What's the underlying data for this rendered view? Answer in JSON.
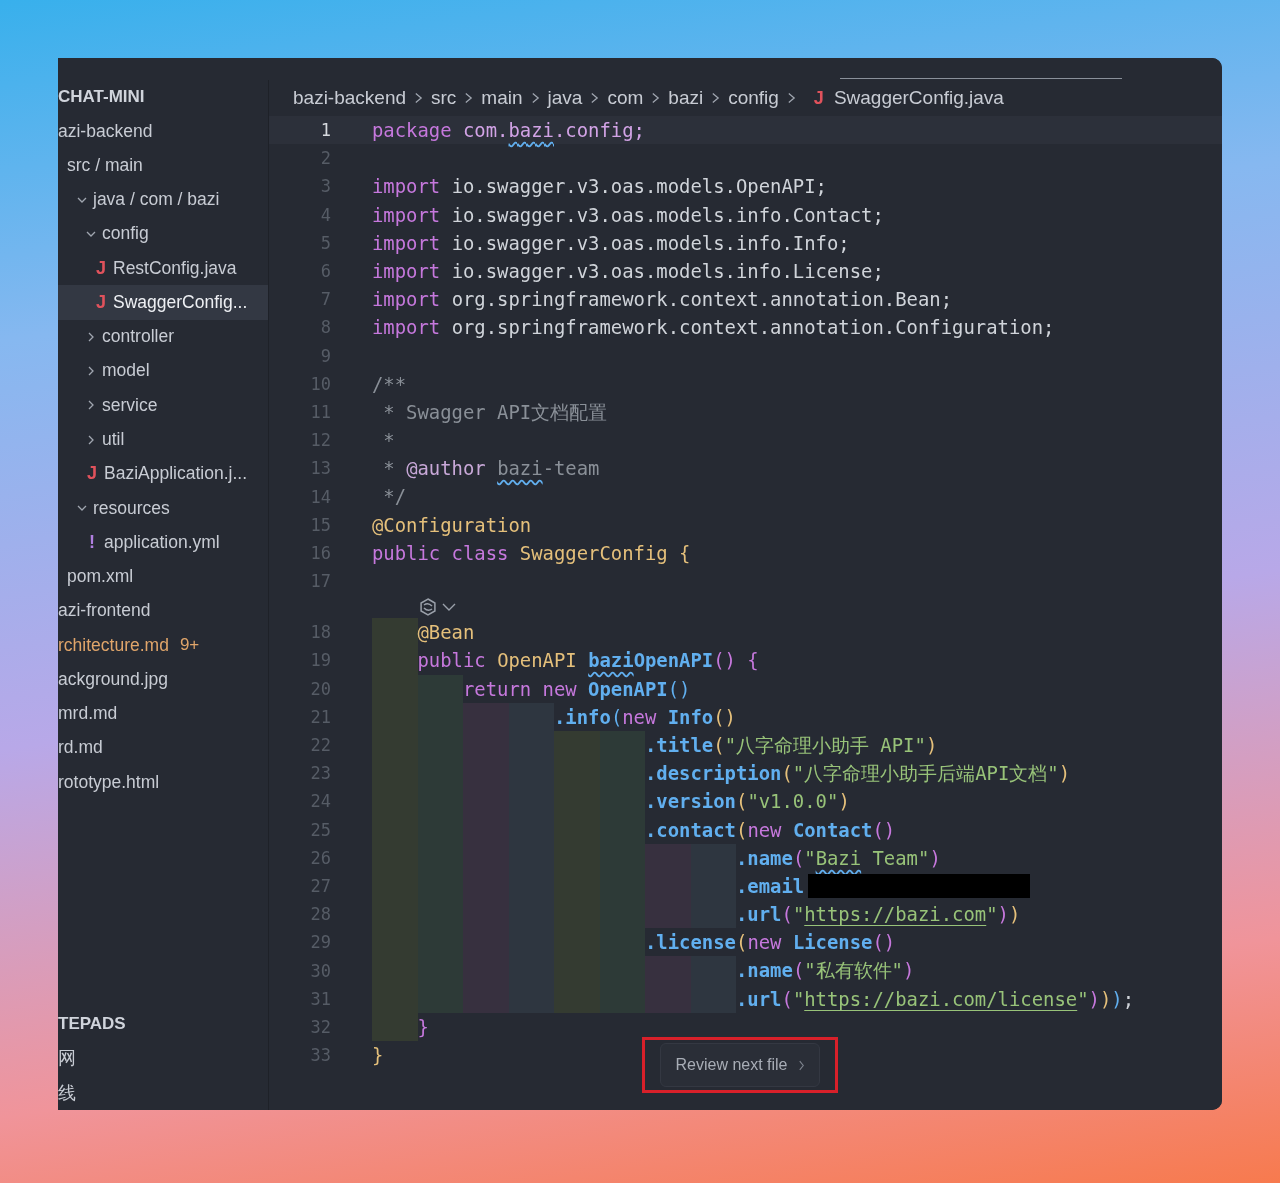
{
  "sidebar": {
    "title": "CHAT-MINI",
    "items": [
      {
        "label": "azi-backend",
        "selected": false,
        "modified": false,
        "children": [
          {
            "label": "src / main",
            "selected": false,
            "children": [
              {
                "label": "java / com / bazi",
                "expanded": true,
                "selected": false,
                "children": [
                  {
                    "label": "config",
                    "expanded": true,
                    "selected": false,
                    "children": [
                      {
                        "label": "RestConfig.java",
                        "icon": "J",
                        "color": "#e0525c",
                        "selected": false
                      },
                      {
                        "label": "SwaggerConfig...",
                        "icon": "J",
                        "color": "#e0525c",
                        "selected": true
                      }
                    ]
                  },
                  {
                    "label": "controller",
                    "expanded": false,
                    "selected": false
                  },
                  {
                    "label": "model",
                    "expanded": false,
                    "selected": false
                  },
                  {
                    "label": "service",
                    "expanded": false,
                    "selected": false
                  },
                  {
                    "label": "util",
                    "expanded": false,
                    "selected": false
                  },
                  {
                    "label": "BaziApplication.j...",
                    "icon": "J",
                    "color": "#e0525c",
                    "selected": false
                  }
                ]
              },
              {
                "label": "resources",
                "expanded": true,
                "selected": false,
                "children": [
                  {
                    "label": "application.yml",
                    "icon": "!",
                    "color": "#b07fe0",
                    "selected": false
                  }
                ]
              }
            ]
          },
          {
            "label": "pom.xml",
            "selected": false
          }
        ]
      },
      {
        "label": "azi-frontend",
        "selected": false,
        "modified": false
      },
      {
        "label": "rchitecture.md",
        "selected": false,
        "modified": true,
        "badge": "9+"
      },
      {
        "label": "ackground.jpg",
        "selected": false,
        "modified": false
      },
      {
        "label": "mrd.md",
        "selected": false,
        "modified": false
      },
      {
        "label": "rd.md",
        "selected": false,
        "modified": false
      },
      {
        "label": "rototype.html",
        "selected": false,
        "modified": false
      }
    ],
    "section": {
      "title": "TEPADS",
      "items": [
        {
          "label": "网"
        },
        {
          "label": "线"
        }
      ]
    }
  },
  "breadcrumb": [
    {
      "label": "bazi-backend"
    },
    {
      "label": "src"
    },
    {
      "label": "main"
    },
    {
      "label": "java"
    },
    {
      "label": "com"
    },
    {
      "label": "bazi"
    },
    {
      "label": "config"
    },
    {
      "label": "SwaggerConfig.java",
      "icon": "J"
    }
  ],
  "editor": {
    "lines": [
      {
        "kind": "code",
        "number": "1",
        "current": true,
        "tokens": [
          {
            "kind": "kw",
            "text": "package "
          },
          {
            "kind": "pkg",
            "text": "com."
          },
          {
            "kind": "pkgsq",
            "text": "bazi"
          },
          {
            "kind": "pkg",
            "text": ".config;"
          }
        ]
      },
      {
        "kind": "code",
        "number": "2",
        "current": false
      },
      {
        "kind": "code",
        "number": "3",
        "current": false,
        "tokens": [
          {
            "kind": "kw",
            "text": "import "
          },
          {
            "kind": "plain",
            "text": "io.swagger.v3.oas.models.OpenAPI;"
          }
        ]
      },
      {
        "kind": "code",
        "number": "4",
        "current": false,
        "tokens": [
          {
            "kind": "kw",
            "text": "import "
          },
          {
            "kind": "plain",
            "text": "io.swagger.v3.oas.models.info.Contact;"
          }
        ]
      },
      {
        "kind": "code",
        "number": "5",
        "current": false,
        "tokens": [
          {
            "kind": "kw",
            "text": "import "
          },
          {
            "kind": "plain",
            "text": "io.swagger.v3.oas.models.info.Info;"
          }
        ]
      },
      {
        "kind": "code",
        "number": "6",
        "current": false,
        "tokens": [
          {
            "kind": "kw",
            "text": "import "
          },
          {
            "kind": "plain",
            "text": "io.swagger.v3.oas.models.info.License;"
          }
        ]
      },
      {
        "kind": "code",
        "number": "7",
        "current": false,
        "tokens": [
          {
            "kind": "kw",
            "text": "import "
          },
          {
            "kind": "plain",
            "text": "org.springframework.context.annotation.Bean;"
          }
        ]
      },
      {
        "kind": "code",
        "number": "8",
        "current": false,
        "tokens": [
          {
            "kind": "kw",
            "text": "import "
          },
          {
            "kind": "plain",
            "text": "org.springframework.context.annotation.Configuration;"
          }
        ]
      },
      {
        "kind": "code",
        "number": "9",
        "current": false
      },
      {
        "kind": "code",
        "number": "10",
        "current": false,
        "tokens": [
          {
            "kind": "cmt",
            "text": "/**"
          }
        ]
      },
      {
        "kind": "code",
        "number": "11",
        "current": false,
        "tokens": [
          {
            "kind": "cmt",
            "text": " * Swagger API文档配置"
          }
        ]
      },
      {
        "kind": "code",
        "number": "12",
        "current": false,
        "tokens": [
          {
            "kind": "cmt",
            "text": " *"
          }
        ]
      },
      {
        "kind": "code",
        "number": "13",
        "current": false,
        "tokens": [
          {
            "kind": "cmt",
            "text": " * "
          },
          {
            "kind": "doc",
            "text": "@author "
          },
          {
            "kind": "cmtsq",
            "text": "bazi"
          },
          {
            "kind": "cmt",
            "text": "-team"
          }
        ]
      },
      {
        "kind": "code",
        "number": "14",
        "current": false,
        "tokens": [
          {
            "kind": "cmt",
            "text": " */"
          }
        ]
      },
      {
        "kind": "code",
        "number": "15",
        "current": false,
        "tokens": [
          {
            "kind": "ann",
            "text": "@Configuration"
          }
        ]
      },
      {
        "kind": "code",
        "number": "16",
        "current": false,
        "tokens": [
          {
            "kind": "kw",
            "text": "public class "
          },
          {
            "kind": "type",
            "text": "SwaggerConfig "
          },
          {
            "kind": "b1",
            "text": "{"
          }
        ]
      },
      {
        "kind": "code",
        "number": "17",
        "current": false
      },
      {
        "kind": "lens"
      },
      {
        "kind": "code",
        "number": "18",
        "current": false,
        "tokens": [
          {
            "kind": "ann",
            "text": "    @Bean"
          }
        ]
      },
      {
        "kind": "code",
        "number": "19",
        "current": false,
        "tokens": [
          {
            "kind": "kw",
            "text": "    public "
          },
          {
            "kind": "type",
            "text": "OpenAPI "
          },
          {
            "kind": "fnsq",
            "text": "bazi"
          },
          {
            "kind": "fn",
            "text": "OpenAPI"
          },
          {
            "kind": "b2",
            "text": "() {"
          }
        ]
      },
      {
        "kind": "code",
        "number": "20",
        "current": false,
        "tokens": [
          {
            "kind": "kw",
            "text": "        return new "
          },
          {
            "kind": "fn",
            "text": "OpenAPI"
          },
          {
            "kind": "b3",
            "text": "()"
          }
        ]
      },
      {
        "kind": "code",
        "number": "21",
        "current": false,
        "tokens": [
          {
            "kind": "fn",
            "text": "                .info"
          },
          {
            "kind": "b3",
            "text": "("
          },
          {
            "kind": "kw",
            "text": "new "
          },
          {
            "kind": "fn",
            "text": "Info"
          },
          {
            "kind": "b1",
            "text": "()"
          }
        ]
      },
      {
        "kind": "code",
        "number": "22",
        "current": false,
        "tokens": [
          {
            "kind": "fn",
            "text": "                        .title"
          },
          {
            "kind": "b1",
            "text": "("
          },
          {
            "kind": "str",
            "text": "\"八字命理小助手 API\""
          },
          {
            "kind": "b1",
            "text": ")"
          }
        ]
      },
      {
        "kind": "code",
        "number": "23",
        "current": false,
        "tokens": [
          {
            "kind": "fn",
            "text": "                        .description"
          },
          {
            "kind": "b1",
            "text": "("
          },
          {
            "kind": "str",
            "text": "\"八字命理小助手后端API文档\""
          },
          {
            "kind": "b1",
            "text": ")"
          }
        ]
      },
      {
        "kind": "code",
        "number": "24",
        "current": false,
        "tokens": [
          {
            "kind": "fn",
            "text": "                        .version"
          },
          {
            "kind": "b1",
            "text": "("
          },
          {
            "kind": "str",
            "text": "\"v1.0.0\""
          },
          {
            "kind": "b1",
            "text": ")"
          }
        ]
      },
      {
        "kind": "code",
        "number": "25",
        "current": false,
        "tokens": [
          {
            "kind": "fn",
            "text": "                        .contact"
          },
          {
            "kind": "b1",
            "text": "("
          },
          {
            "kind": "kw",
            "text": "new "
          },
          {
            "kind": "fn",
            "text": "Contact"
          },
          {
            "kind": "b2",
            "text": "()"
          }
        ]
      },
      {
        "kind": "code",
        "number": "26",
        "current": false,
        "tokens": [
          {
            "kind": "fn",
            "text": "                                .name"
          },
          {
            "kind": "b2",
            "text": "("
          },
          {
            "kind": "str",
            "text": "\""
          },
          {
            "kind": "strsq",
            "text": "Bazi"
          },
          {
            "kind": "str",
            "text": " Team\""
          },
          {
            "kind": "b2",
            "text": ")"
          }
        ]
      },
      {
        "kind": "code",
        "number": "27",
        "current": false,
        "tokens": [
          {
            "kind": "fn",
            "text": "                                .email"
          },
          {
            "kind": "redacted"
          }
        ]
      },
      {
        "kind": "code",
        "number": "28",
        "current": false,
        "tokens": [
          {
            "kind": "fn",
            "text": "                                .url"
          },
          {
            "kind": "b2",
            "text": "("
          },
          {
            "kind": "str",
            "text": "\""
          },
          {
            "kind": "link",
            "text": "https://bazi.com"
          },
          {
            "kind": "str",
            "text": "\""
          },
          {
            "kind": "b2",
            "text": ")"
          },
          {
            "kind": "b1",
            "text": ")"
          }
        ]
      },
      {
        "kind": "code",
        "number": "29",
        "current": false,
        "tokens": [
          {
            "kind": "fn",
            "text": "                        .license"
          },
          {
            "kind": "b1",
            "text": "("
          },
          {
            "kind": "kw",
            "text": "new "
          },
          {
            "kind": "fn",
            "text": "License"
          },
          {
            "kind": "b2",
            "text": "()"
          }
        ]
      },
      {
        "kind": "code",
        "number": "30",
        "current": false,
        "tokens": [
          {
            "kind": "fn",
            "text": "                                .name"
          },
          {
            "kind": "b2",
            "text": "("
          },
          {
            "kind": "str",
            "text": "\"私有软件\""
          },
          {
            "kind": "b2",
            "text": ")"
          }
        ]
      },
      {
        "kind": "code",
        "number": "31",
        "current": false,
        "tokens": [
          {
            "kind": "fn",
            "text": "                                .url"
          },
          {
            "kind": "b2",
            "text": "("
          },
          {
            "kind": "str",
            "text": "\""
          },
          {
            "kind": "link",
            "text": "https://bazi.com/license"
          },
          {
            "kind": "str",
            "text": "\""
          },
          {
            "kind": "b2",
            "text": ")"
          },
          {
            "kind": "b1",
            "text": ")"
          },
          {
            "kind": "b3",
            "text": ")"
          },
          {
            "kind": "plain",
            "text": ";"
          }
        ]
      },
      {
        "kind": "code",
        "number": "32",
        "current": false,
        "tokens": [
          {
            "kind": "b2",
            "text": "    }"
          }
        ]
      },
      {
        "kind": "code",
        "number": "33",
        "current": false,
        "tokens": [
          {
            "kind": "b1",
            "text": "}"
          }
        ]
      }
    ]
  },
  "review_button": {
    "label": "Review next file"
  }
}
